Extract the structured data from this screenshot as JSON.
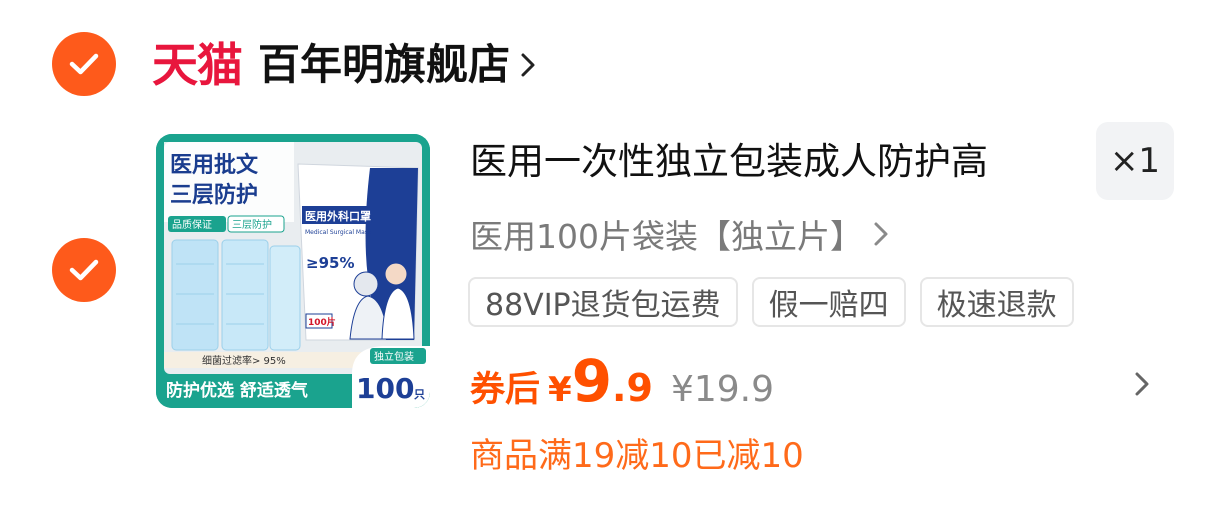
{
  "store": {
    "brand_logo_text": "天猫",
    "name": "百年明旗舰店"
  },
  "item": {
    "title": "医用一次性独立包装成人防护高",
    "quantity": "×1",
    "sku": "医用100片袋装【独立片】",
    "tags": [
      "88VIP退货包运费",
      "假一赔四",
      "极速退款"
    ],
    "price_label": "券后",
    "currency": "¥",
    "price_integer": "9",
    "price_decimal": ".9",
    "original_price": "¥19.9",
    "promo_text": "商品满19减10已减10"
  },
  "product_image_text": {
    "headline_1": "医用批文",
    "headline_2": "三层防护",
    "badge_1": "品质保证",
    "badge_2": "三层防护",
    "pack_title": "医用外科口罩",
    "pack_subtitle": "Medical Surgical Mask",
    "pack_percent": "≥95%",
    "pack_count": "100片",
    "filter_text": "细菌过滤率> 95%",
    "bottom_slogan": "防护优选 舒适透气",
    "independent_pack": "独立包装",
    "count_big": "100",
    "count_unit": "只"
  },
  "colors": {
    "accent_orange": "#fe5a1b",
    "tmall_red": "#e8163d",
    "price_orange": "#ff5000",
    "image_teal": "#1aa38e"
  },
  "icons": {
    "check": "check-circle-icon",
    "chevron": "chevron-right-icon"
  }
}
